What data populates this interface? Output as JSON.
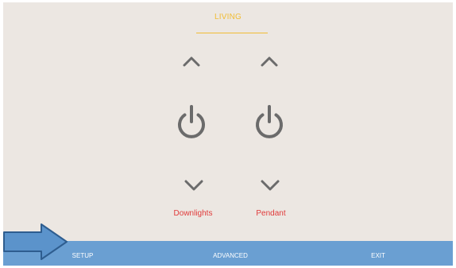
{
  "colors": {
    "accent": "#f1bd35",
    "label": "#e03a3a",
    "bar": "#6a9fd2",
    "icon": "#6b6b6b",
    "arrow_fill": "#5b93cb",
    "arrow_stroke": "#2e5d8f"
  },
  "header": {
    "title": "LIVING"
  },
  "channels": [
    {
      "label": "Downlights",
      "icons": [
        "chevron-up-icon",
        "power-icon",
        "chevron-down-icon"
      ]
    },
    {
      "label": "Pendant",
      "icons": [
        "chevron-up-icon",
        "power-icon",
        "chevron-down-icon"
      ]
    }
  ],
  "footer": {
    "setup": "SETUP",
    "advanced": "ADVANCED",
    "exit": "EXIT"
  },
  "overlay": {
    "icon": "arrow-right-icon"
  }
}
